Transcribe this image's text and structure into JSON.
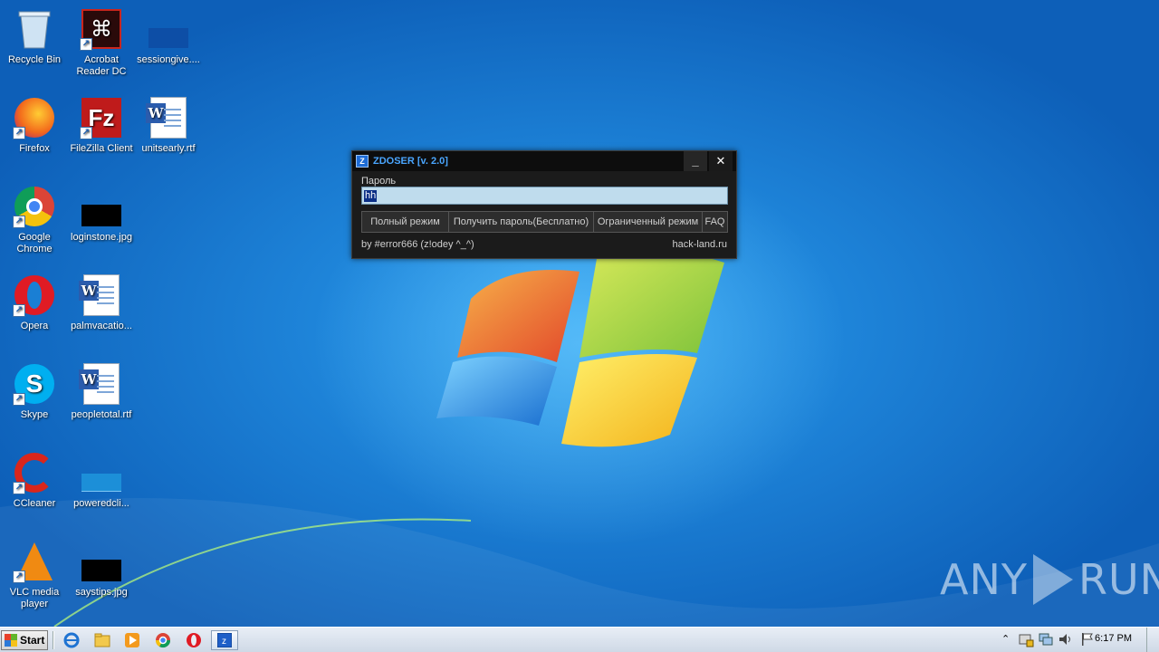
{
  "desktop": {
    "icons": [
      {
        "label": "Recycle Bin"
      },
      {
        "label": "Acrobat Reader DC"
      },
      {
        "label": "sessiongive...."
      },
      {
        "label": "Firefox"
      },
      {
        "label": "FileZilla Client"
      },
      {
        "label": "unitsearly.rtf"
      },
      {
        "label": "Google Chrome"
      },
      {
        "label": "loginstone.jpg"
      },
      {
        "label": "Opera"
      },
      {
        "label": "palmvacatio..."
      },
      {
        "label": "Skype"
      },
      {
        "label": "peopletotal.rtf"
      },
      {
        "label": "CCleaner"
      },
      {
        "label": "poweredcli..."
      },
      {
        "label": "VLC media player"
      },
      {
        "label": "saystips.jpg"
      }
    ]
  },
  "app": {
    "logo_letter": "Z",
    "title": "ZDOSER [v. 2.0]",
    "minimize_label": "_",
    "close_label": "✕",
    "password_label": "Пароль",
    "password_value": "hh",
    "buttons": [
      {
        "label": "Полный режим"
      },
      {
        "label": "Получить пароль(Бесплатно)"
      },
      {
        "label": "Ограниченный режим"
      },
      {
        "label": "FAQ"
      }
    ],
    "footer_left": "by #error666 (z!odey ^_^)",
    "footer_right": "hack-land.ru"
  },
  "watermark": {
    "left": "ANY",
    "right": "RUN"
  },
  "taskbar": {
    "start_label": "Start",
    "clock": "6:17 PM"
  }
}
